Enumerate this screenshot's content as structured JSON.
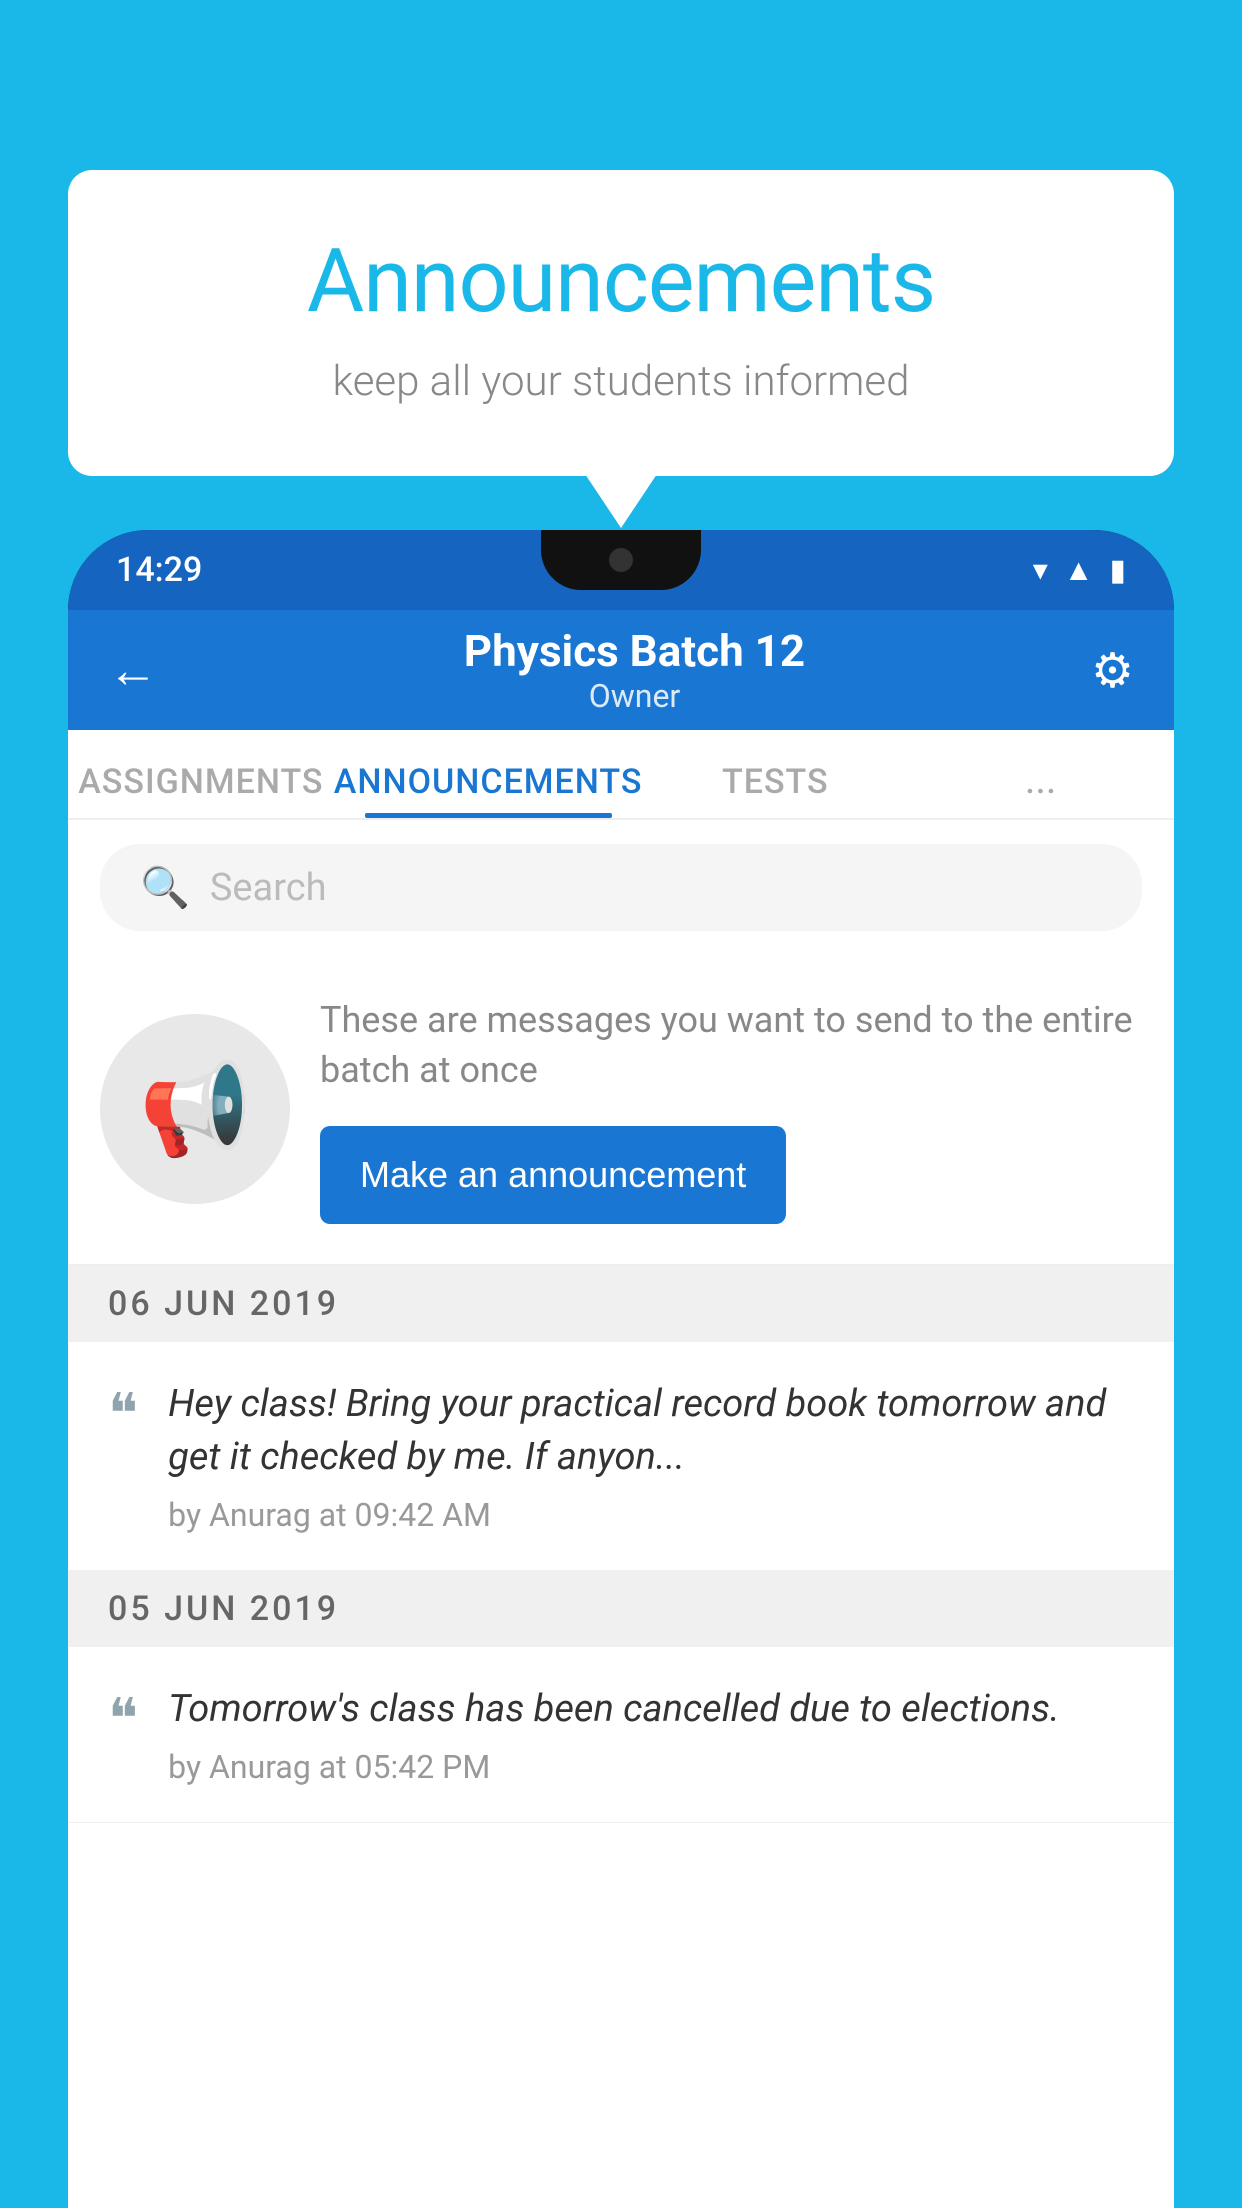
{
  "background_color": "#1ab8e8",
  "speech_bubble": {
    "title": "Announcements",
    "subtitle": "keep all your students informed"
  },
  "phone": {
    "status_bar": {
      "time": "14:29",
      "icons": [
        "wifi",
        "signal",
        "battery"
      ]
    },
    "header": {
      "title": "Physics Batch 12",
      "subtitle": "Owner",
      "back_label": "←",
      "settings_label": "⚙"
    },
    "tabs": [
      {
        "label": "ASSIGNMENTS",
        "active": false
      },
      {
        "label": "ANNOUNCEMENTS",
        "active": true
      },
      {
        "label": "TESTS",
        "active": false
      },
      {
        "label": "...",
        "active": false
      }
    ],
    "search": {
      "placeholder": "Search"
    },
    "promo": {
      "description": "These are messages you want to send to the entire batch at once",
      "button_label": "Make an announcement"
    },
    "announcements": [
      {
        "date": "06  JUN  2019",
        "text": "Hey class! Bring your practical record book tomorrow and get it checked by me. If anyon...",
        "meta": "by Anurag at 09:42 AM"
      },
      {
        "date": "05  JUN  2019",
        "text": "Tomorrow's class has been cancelled due to elections.",
        "meta": "by Anurag at 05:42 PM"
      }
    ]
  }
}
